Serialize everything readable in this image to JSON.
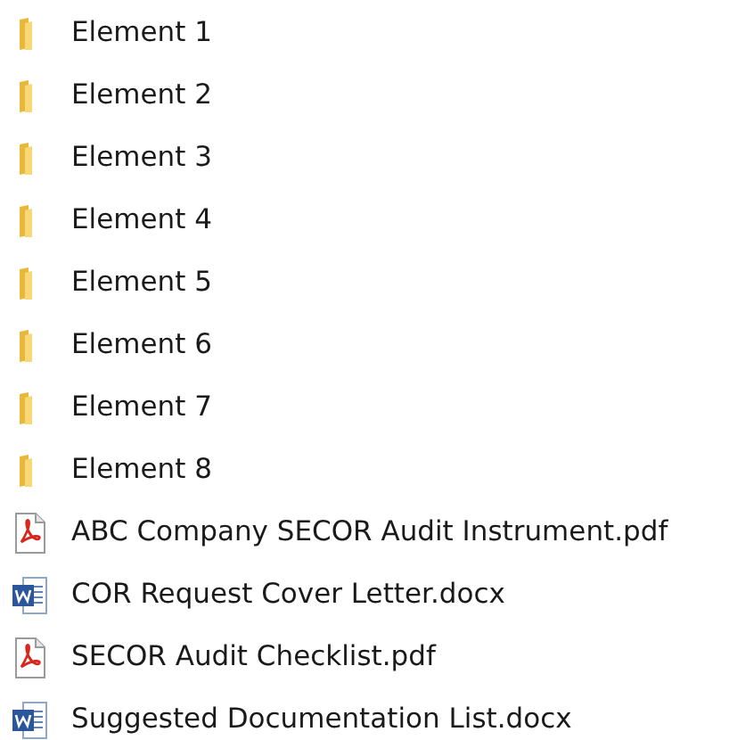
{
  "files": [
    {
      "kind": "folder",
      "label": "Element 1"
    },
    {
      "kind": "folder",
      "label": "Element 2"
    },
    {
      "kind": "folder",
      "label": "Element 3"
    },
    {
      "kind": "folder",
      "label": "Element 4"
    },
    {
      "kind": "folder",
      "label": "Element 5"
    },
    {
      "kind": "folder",
      "label": "Element 6"
    },
    {
      "kind": "folder",
      "label": "Element 7"
    },
    {
      "kind": "folder",
      "label": "Element 8"
    },
    {
      "kind": "pdf",
      "label": "ABC Company SECOR Audit Instrument.pdf"
    },
    {
      "kind": "docx",
      "label": "COR Request Cover Letter.docx"
    },
    {
      "kind": "pdf",
      "label": "SECOR Audit Checklist.pdf"
    },
    {
      "kind": "docx",
      "label": "Suggested Documentation List.docx"
    }
  ]
}
